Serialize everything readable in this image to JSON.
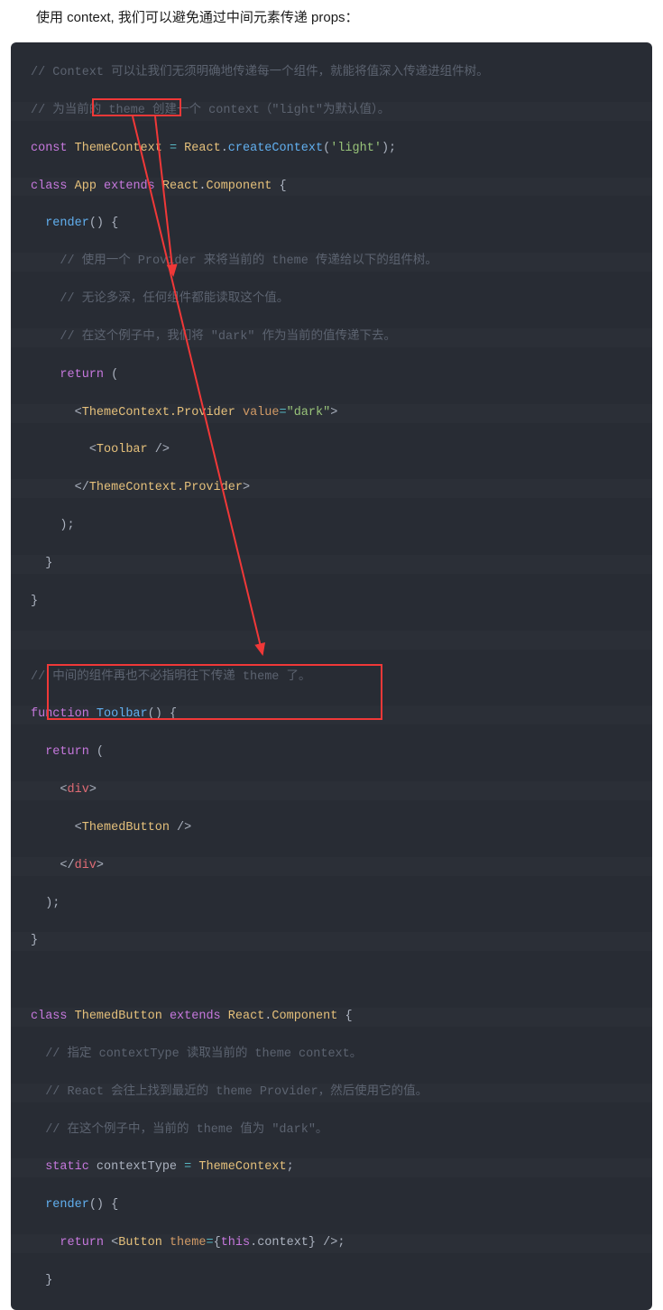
{
  "intro": "使用 context, 我们可以避免通过中间元素传递 props：",
  "code": {
    "l1": "// Context 可以让我们无须明确地传递每一个组件，就能将值深入传递进组件树。",
    "l2": "// 为当前的 theme 创建一个 context（\"light\"为默认值）。",
    "l3a": "const",
    "l3b": "ThemeContext",
    "l3c": "=",
    "l3d": "React",
    "l3e": "createContext",
    "l3f": "'light'",
    "l4a": "class",
    "l4b": "App",
    "l4c": "extends",
    "l4d": "React",
    "l4e": "Component",
    "l5a": "render",
    "l6": "// 使用一个 Provider 来将当前的 theme 传递给以下的组件树。",
    "l7": "// 无论多深，任何组件都能读取这个值。",
    "l8": "// 在这个例子中，我们将 \"dark\" 作为当前的值传递下去。",
    "l9a": "return",
    "l10a": "ThemeContext.Provider",
    "l10b": "value",
    "l10c": "\"dark\"",
    "l11a": "Toolbar",
    "l12a": "ThemeContext.Provider",
    "l16": "// 中间的组件再也不必指明往下传递 theme 了。",
    "l17a": "function",
    "l17b": "Toolbar",
    "l18a": "return",
    "l19a": "div",
    "l20a": "ThemedButton",
    "l21a": "div",
    "l25a": "class",
    "l25b": "ThemedButton",
    "l25c": "extends",
    "l25d": "React",
    "l25e": "Component",
    "l26": "// 指定 contextType 读取当前的 theme context。",
    "l27": "// React 会往上找到最近的 theme Provider，然后使用它的值。",
    "l28": "// 在这个例子中，当前的 theme 值为 \"dark\"。",
    "l29a": "static",
    "l29b": "contextType",
    "l29c": "ThemeContext",
    "l30a": "render",
    "l31a": "return",
    "l31b": "Button",
    "l31c": "theme",
    "l31d": "this",
    "l31e": "context"
  }
}
